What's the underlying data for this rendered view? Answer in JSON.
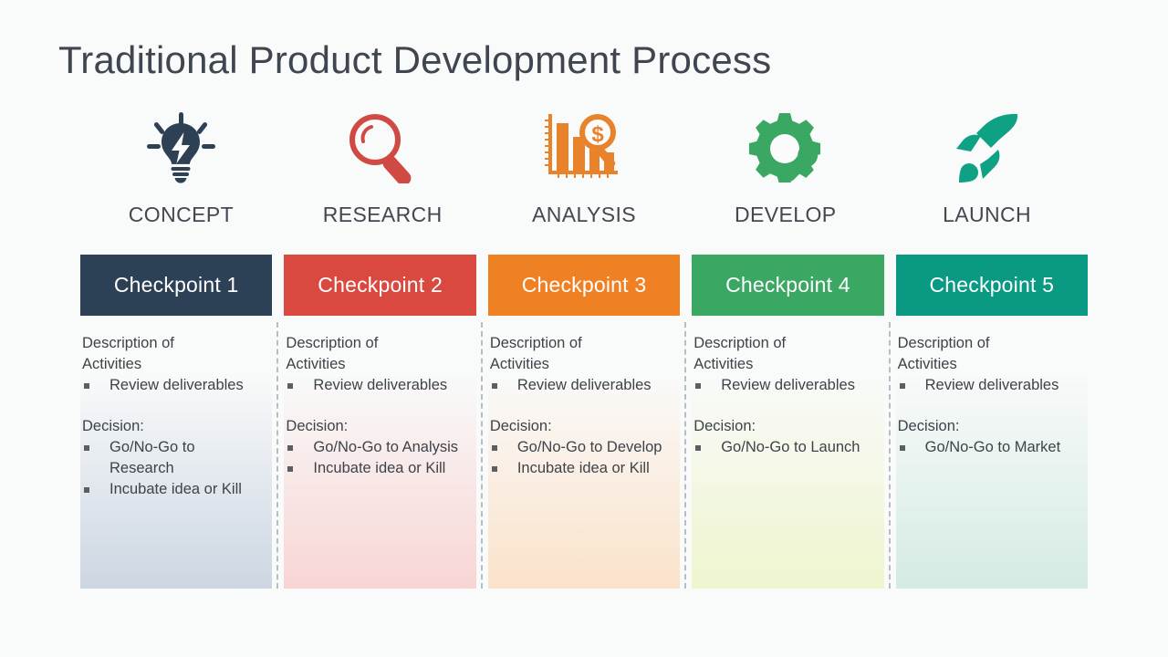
{
  "slide": {
    "title": "Traditional Product Development Process",
    "background_color": "#f9fafa",
    "title_color": "#3f4650"
  },
  "stages": [
    {
      "label": "CONCEPT",
      "icon": "lightbulb-idea-icon",
      "icon_color": "#2e4053"
    },
    {
      "label": "RESEARCH",
      "icon": "magnifying-glass-icon",
      "icon_color": "#cf4a42"
    },
    {
      "label": "ANALYSIS",
      "icon": "bar-chart-dollar-icon",
      "icon_color": "#e8822b"
    },
    {
      "label": "DEVELOP",
      "icon": "gear-wrench-icon",
      "icon_color": "#3aa862"
    },
    {
      "label": "LAUNCH",
      "icon": "rocket-icon",
      "icon_color": "#0fa183"
    }
  ],
  "checkpoints": [
    {
      "label": "Checkpoint 1",
      "color": "#2d4156",
      "tint": "#ccd6e2"
    },
    {
      "label": "Checkpoint 2",
      "color": "#d9493f",
      "tint": "#f8d5d4"
    },
    {
      "label": "Checkpoint 3",
      "color": "#ef8023",
      "tint": "#fbe2ca"
    },
    {
      "label": "Checkpoint 4",
      "color": "#3aa862",
      "tint": "#eef5ce"
    },
    {
      "label": "Checkpoint 5",
      "color": "#0a9a84",
      "tint": "#d4ebe2"
    }
  ],
  "columns": [
    {
      "activities_heading": "Description of Activities",
      "activities": [
        "Review deliverables"
      ],
      "decision_heading": "Decision:",
      "decisions": [
        "Go/No-Go to Research",
        "Incubate idea or Kill"
      ]
    },
    {
      "activities_heading": "Description of Activities",
      "activities": [
        "Review deliverables"
      ],
      "decision_heading": "Decision:",
      "decisions": [
        "Go/No-Go to Analysis",
        "Incubate idea or Kill"
      ]
    },
    {
      "activities_heading": "Description of Activities",
      "activities": [
        "Review deliverables"
      ],
      "decision_heading": "Decision:",
      "decisions": [
        "Go/No-Go to Develop",
        "Incubate idea or Kill"
      ]
    },
    {
      "activities_heading": "Description of Activities",
      "activities": [
        "Review deliverables"
      ],
      "decision_heading": "Decision:",
      "decisions": [
        "Go/No-Go to Launch"
      ]
    },
    {
      "activities_heading": "Description of Activities",
      "activities": [
        "Review deliverables"
      ],
      "decision_heading": "Decision:",
      "decisions": [
        "Go/No-Go to Market"
      ]
    }
  ]
}
